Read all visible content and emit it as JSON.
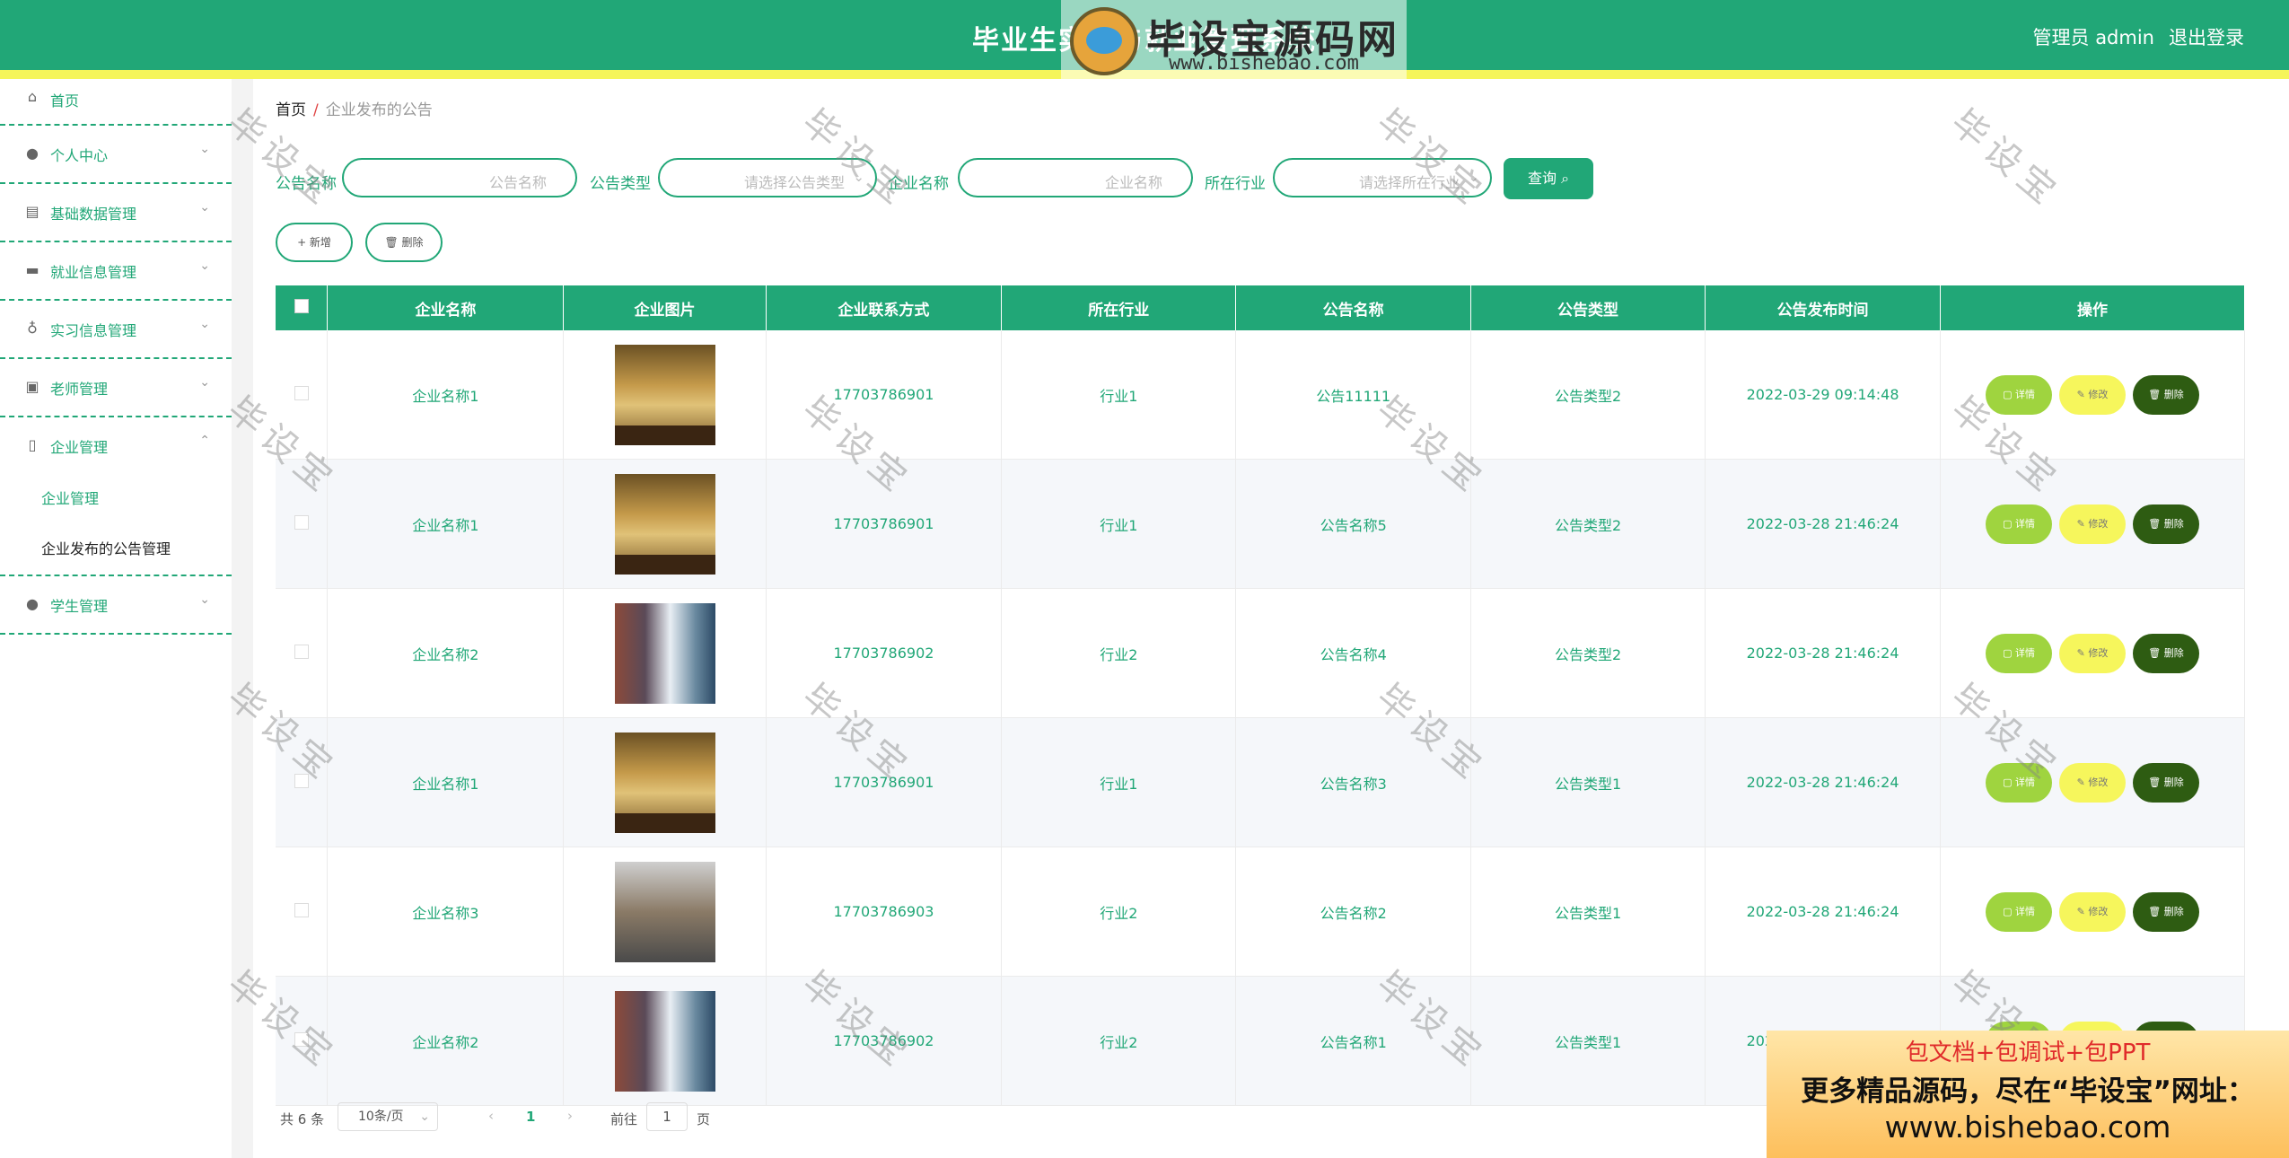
{
  "header": {
    "title": "毕业生实习与就业管理系统",
    "user": "管理员 admin",
    "logout": "退出登录"
  },
  "logo_watermark": {
    "name": "毕设宝源码网",
    "url": "www.bishebao.com"
  },
  "sidebar": {
    "items": [
      {
        "label": "首页",
        "icon": "home-icon"
      },
      {
        "label": "个人中心",
        "icon": "user-icon"
      },
      {
        "label": "基础数据管理",
        "icon": "clipboard-icon"
      },
      {
        "label": "就业信息管理",
        "icon": "monitor-icon"
      },
      {
        "label": "实习信息管理",
        "icon": "microphone-icon"
      },
      {
        "label": "老师管理",
        "icon": "checklist-icon"
      },
      {
        "label": "企业管理",
        "icon": "bookmark-icon"
      },
      {
        "label": "学生管理",
        "icon": "user-icon"
      }
    ],
    "subitems": [
      "企业管理",
      "企业发布的公告管理"
    ]
  },
  "breadcrumb": {
    "home": "首页",
    "sep": "/",
    "current": "企业发布的公告"
  },
  "search": {
    "notice_name_label": "公告名称",
    "notice_name_placeholder": "公告名称",
    "notice_type_label": "公告类型",
    "notice_type_placeholder": "请选择公告类型",
    "company_name_label": "企业名称",
    "company_name_placeholder": "企业名称",
    "industry_label": "所在行业",
    "industry_placeholder": "请选择所在行业",
    "query_button": "查询"
  },
  "actions": {
    "add": "+ 新增",
    "delete": "删除"
  },
  "table": {
    "columns": [
      "企业名称",
      "企业图片",
      "企业联系方式",
      "所在行业",
      "公告名称",
      "公告类型",
      "公告发布时间",
      "操作"
    ],
    "rows": [
      {
        "company": "企业名称1",
        "phone": "17703786901",
        "industry": "行业1",
        "notice": "公告11111",
        "type": "公告类型2",
        "time": "2022-03-29 09:14:48"
      },
      {
        "company": "企业名称1",
        "phone": "17703786901",
        "industry": "行业1",
        "notice": "公告名称5",
        "type": "公告类型2",
        "time": "2022-03-28 21:46:24"
      },
      {
        "company": "企业名称2",
        "phone": "17703786902",
        "industry": "行业2",
        "notice": "公告名称4",
        "type": "公告类型2",
        "time": "2022-03-28 21:46:24"
      },
      {
        "company": "企业名称1",
        "phone": "17703786901",
        "industry": "行业1",
        "notice": "公告名称3",
        "type": "公告类型1",
        "time": "2022-03-28 21:46:24"
      },
      {
        "company": "企业名称3",
        "phone": "17703786903",
        "industry": "行业2",
        "notice": "公告名称2",
        "type": "公告类型1",
        "time": "2022-03-28 21:46:24"
      },
      {
        "company": "企业名称2",
        "phone": "17703786902",
        "industry": "行业2",
        "notice": "公告名称1",
        "type": "公告类型1",
        "time": "2022-03-28 21:46:24"
      }
    ],
    "op_detail": "详情",
    "op_edit": "修改",
    "op_delete": "删除"
  },
  "pager": {
    "total": "共 6 条",
    "page_size": "10条/页",
    "current_page": "1",
    "goto_label": "前往",
    "goto_value": "1",
    "page_suffix": "页"
  },
  "watermark_text": "毕设宝",
  "promo": {
    "line1": "包文档+包调试+包PPT",
    "line2": "更多精品源码，尽在“毕设宝”网址：",
    "line3": "www.bishebao.com"
  },
  "colors": {
    "primary": "#21a777",
    "strip": "#f5f55a",
    "detail": "#9fd43f",
    "edit": "#f6f65c",
    "delete": "#2e5c12"
  }
}
